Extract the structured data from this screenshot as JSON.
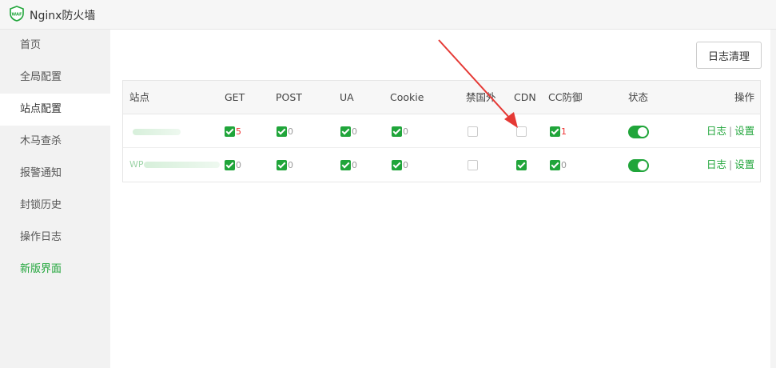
{
  "app": {
    "title": "Nginx防火墙",
    "logo_text": "WAF"
  },
  "sidebar": {
    "items": [
      {
        "label": "首页"
      },
      {
        "label": "全局配置"
      },
      {
        "label": "站点配置"
      },
      {
        "label": "木马查杀"
      },
      {
        "label": "报警通知"
      },
      {
        "label": "封锁历史"
      },
      {
        "label": "操作日志"
      },
      {
        "label": "新版界面"
      }
    ],
    "active": "站点配置"
  },
  "toolbar": {
    "clear_logs_label": "日志清理"
  },
  "table": {
    "headers": [
      "站点",
      "GET",
      "POST",
      "UA",
      "Cookie",
      "禁国外",
      "CDN",
      "CC防御",
      "状态",
      "操作"
    ],
    "rows": [
      {
        "site": "",
        "get": {
          "checked": true,
          "count": "5"
        },
        "post": {
          "checked": true,
          "count": "0"
        },
        "ua": {
          "checked": true,
          "count": "0"
        },
        "cookie": {
          "checked": true,
          "count": "0"
        },
        "foreign": {
          "checked": false
        },
        "cdn": {
          "checked": false
        },
        "cc": {
          "checked": true,
          "count": "1"
        },
        "status": true,
        "log_label": "日志",
        "settings_label": "设置"
      },
      {
        "site": "WP",
        "get": {
          "checked": true,
          "count": "0"
        },
        "post": {
          "checked": true,
          "count": "0"
        },
        "ua": {
          "checked": true,
          "count": "0"
        },
        "cookie": {
          "checked": true,
          "count": "0"
        },
        "foreign": {
          "checked": false
        },
        "cdn": {
          "checked": true
        },
        "cc": {
          "checked": true,
          "count": "0"
        },
        "status": true,
        "log_label": "日志",
        "settings_label": "设置"
      }
    ]
  },
  "colors": {
    "accent": "#20a53a",
    "alert": "#e33333",
    "annotation_arrow": "#e53935"
  }
}
